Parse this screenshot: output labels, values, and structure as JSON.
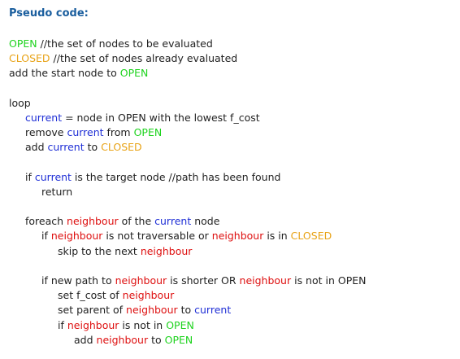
{
  "colors": {
    "title": "#1a5e9e",
    "plain": "#222222",
    "open": "#1ed31e",
    "closed": "#e8a317",
    "current": "#1f2fd6",
    "neighbour": "#de1010"
  },
  "title": "Pseudo code:",
  "lines": [
    {
      "indent": 0,
      "segments": [
        {
          "text": "OPEN",
          "style": "open"
        },
        {
          "text": " //the set of nodes to be evaluated",
          "style": "plain"
        }
      ]
    },
    {
      "indent": 0,
      "segments": [
        {
          "text": "CLOSED",
          "style": "closed"
        },
        {
          "text": " //the set of nodes already evaluated",
          "style": "plain"
        }
      ]
    },
    {
      "indent": 0,
      "segments": [
        {
          "text": "add the start node to ",
          "style": "plain"
        },
        {
          "text": "OPEN",
          "style": "open"
        }
      ]
    },
    {
      "indent": 0,
      "segments": []
    },
    {
      "indent": 0,
      "segments": [
        {
          "text": "loop",
          "style": "plain"
        }
      ]
    },
    {
      "indent": 1,
      "segments": [
        {
          "text": "current",
          "style": "current"
        },
        {
          "text": " = node in OPEN with the lowest f_cost",
          "style": "plain"
        }
      ]
    },
    {
      "indent": 1,
      "segments": [
        {
          "text": "remove ",
          "style": "plain"
        },
        {
          "text": "current",
          "style": "current"
        },
        {
          "text": " from ",
          "style": "plain"
        },
        {
          "text": "OPEN",
          "style": "open"
        }
      ]
    },
    {
      "indent": 1,
      "segments": [
        {
          "text": "add ",
          "style": "plain"
        },
        {
          "text": "current",
          "style": "current"
        },
        {
          "text": " to ",
          "style": "plain"
        },
        {
          "text": "CLOSED",
          "style": "closed"
        }
      ]
    },
    {
      "indent": 0,
      "segments": []
    },
    {
      "indent": 1,
      "segments": [
        {
          "text": "if ",
          "style": "plain"
        },
        {
          "text": "current",
          "style": "current"
        },
        {
          "text": " is the target node //path has been found",
          "style": "plain"
        }
      ]
    },
    {
      "indent": 2,
      "segments": [
        {
          "text": "return",
          "style": "plain"
        }
      ]
    },
    {
      "indent": 0,
      "segments": []
    },
    {
      "indent": 1,
      "segments": [
        {
          "text": "foreach ",
          "style": "plain"
        },
        {
          "text": "neighbour",
          "style": "neighbour"
        },
        {
          "text": " of the ",
          "style": "plain"
        },
        {
          "text": "current",
          "style": "current"
        },
        {
          "text": " node",
          "style": "plain"
        }
      ]
    },
    {
      "indent": 2,
      "segments": [
        {
          "text": "if ",
          "style": "plain"
        },
        {
          "text": "neighbour",
          "style": "neighbour"
        },
        {
          "text": " is not traversable or ",
          "style": "plain"
        },
        {
          "text": "neighbour",
          "style": "neighbour"
        },
        {
          "text": " is in ",
          "style": "plain"
        },
        {
          "text": "CLOSED",
          "style": "closed"
        }
      ]
    },
    {
      "indent": 3,
      "segments": [
        {
          "text": "skip to the next ",
          "style": "plain"
        },
        {
          "text": "neighbour",
          "style": "neighbour"
        }
      ]
    },
    {
      "indent": 0,
      "segments": []
    },
    {
      "indent": 2,
      "segments": [
        {
          "text": "if new path to ",
          "style": "plain"
        },
        {
          "text": "neighbour",
          "style": "neighbour"
        },
        {
          "text": " is shorter OR ",
          "style": "plain"
        },
        {
          "text": "neighbour",
          "style": "neighbour"
        },
        {
          "text": " is not in OPEN",
          "style": "plain"
        }
      ]
    },
    {
      "indent": 3,
      "segments": [
        {
          "text": "set f_cost of ",
          "style": "plain"
        },
        {
          "text": "neighbour",
          "style": "neighbour"
        }
      ]
    },
    {
      "indent": 3,
      "segments": [
        {
          "text": "set parent of ",
          "style": "plain"
        },
        {
          "text": "neighbour",
          "style": "neighbour"
        },
        {
          "text": " to ",
          "style": "plain"
        },
        {
          "text": "current",
          "style": "current"
        }
      ]
    },
    {
      "indent": 3,
      "segments": [
        {
          "text": "if ",
          "style": "plain"
        },
        {
          "text": "neighbour",
          "style": "neighbour"
        },
        {
          "text": " is not in ",
          "style": "plain"
        },
        {
          "text": "OPEN",
          "style": "open"
        }
      ]
    },
    {
      "indent": 4,
      "segments": [
        {
          "text": "add ",
          "style": "plain"
        },
        {
          "text": "neighbour",
          "style": "neighbour"
        },
        {
          "text": " to ",
          "style": "plain"
        },
        {
          "text": "OPEN",
          "style": "open"
        }
      ]
    }
  ]
}
